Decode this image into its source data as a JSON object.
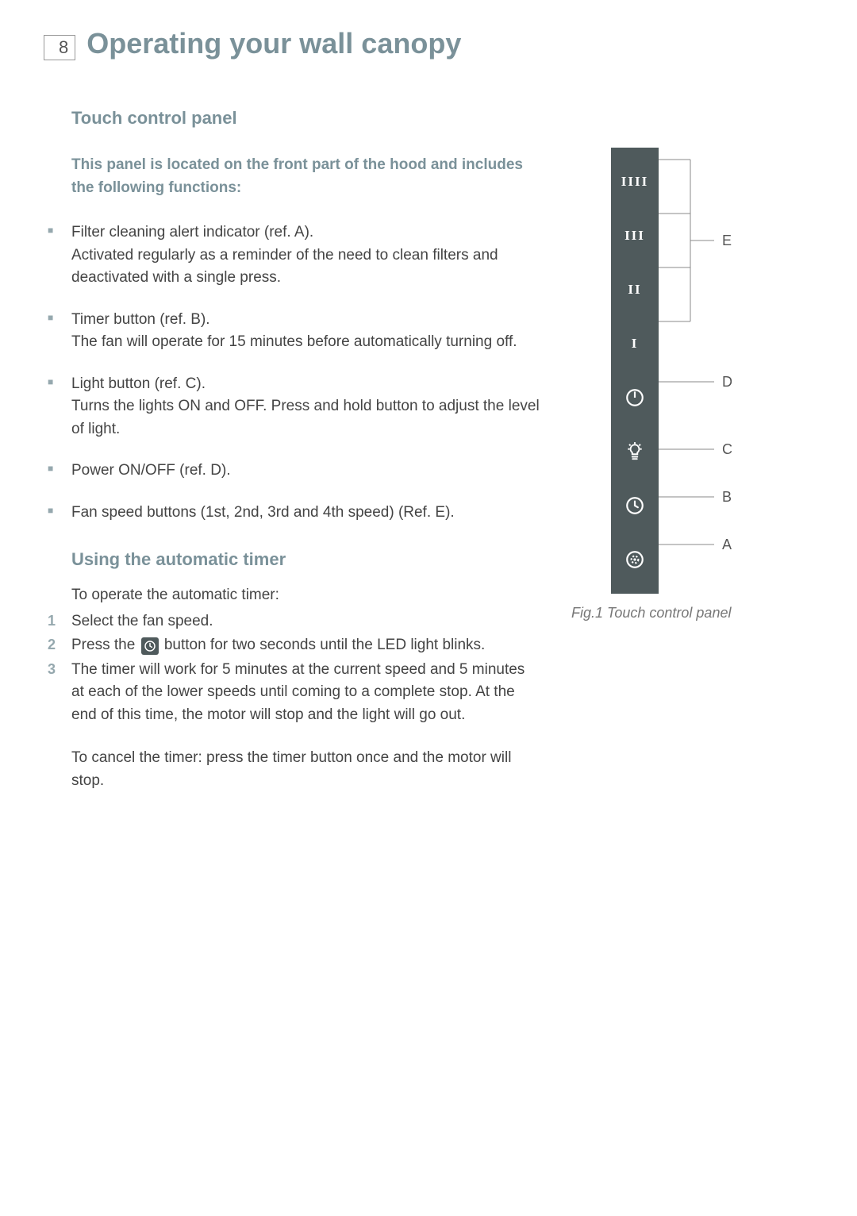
{
  "page_number": "8",
  "page_title": "Operating your wall canopy",
  "section1_title": "Touch control panel",
  "intro_text": "This panel is located on the front part of the hood and includes the following functions:",
  "bullets": [
    {
      "lead": "Filter cleaning alert indicator (ref. A).",
      "desc": "Activated regularly as a reminder of the need to clean filters and deactivated with a single press."
    },
    {
      "lead": "Timer button (ref. B).",
      "desc": "The fan will operate for 15 minutes before automatically turning off."
    },
    {
      "lead": "Light button (ref. C).",
      "desc": "Turns the lights ON and OFF. Press and hold button to adjust the level of light."
    },
    {
      "lead": "Power ON/OFF (ref. D).",
      "desc": ""
    },
    {
      "lead": "Fan speed buttons (1st, 2nd, 3rd and 4th speed) (Ref. E).",
      "desc": ""
    }
  ],
  "section2_title": "Using the automatic timer",
  "timer_intro": "To operate the automatic timer:",
  "steps": {
    "s1": "Select the fan speed.",
    "s2a": "Press the ",
    "s2b": " button for two seconds until the LED light blinks.",
    "s3": "The timer will work for 5 minutes at the current speed and 5 minutes at each of the lower speeds until coming to a complete stop. At the end of this time, the motor will stop and the light will go out."
  },
  "cancel_note": "To cancel the timer: press the timer button once and the motor will stop.",
  "panel": {
    "speed4": "IIII",
    "speed3": "III",
    "speed2": "II",
    "speed1": "I"
  },
  "labels": {
    "A": "A",
    "B": "B",
    "C": "C",
    "D": "D",
    "E": "E"
  },
  "figure_caption": "Fig.1 Touch control panel"
}
